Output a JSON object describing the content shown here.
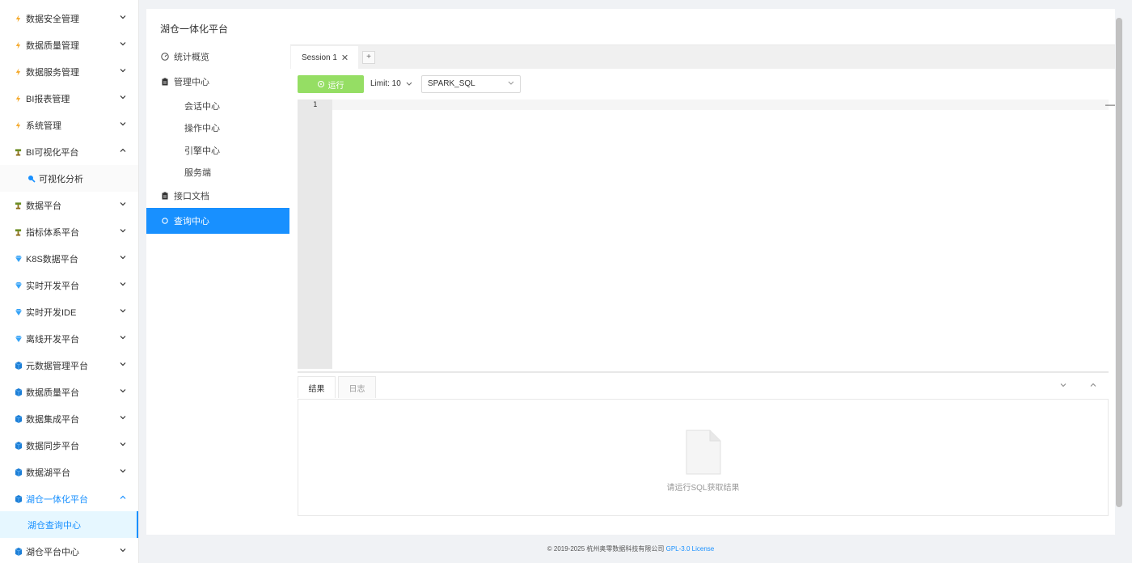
{
  "sidebar": {
    "items": [
      {
        "label": "数据安全管理",
        "icon": "bolt-icon"
      },
      {
        "label": "数据质量管理",
        "icon": "bolt-icon"
      },
      {
        "label": "数据服务管理",
        "icon": "bolt-icon"
      },
      {
        "label": "BI报表管理",
        "icon": "bolt-icon"
      },
      {
        "label": "系统管理",
        "icon": "bolt-icon"
      },
      {
        "label": "BI可视化平台",
        "icon": "tree-icon"
      },
      {
        "label": "可视化分析",
        "icon": "search-icon"
      },
      {
        "label": "数据平台",
        "icon": "tree-icon"
      },
      {
        "label": "指标体系平台",
        "icon": "tree-icon"
      },
      {
        "label": "K8S数据平台",
        "icon": "diamond-icon"
      },
      {
        "label": "实时开发平台",
        "icon": "diamond-icon"
      },
      {
        "label": "实时开发IDE",
        "icon": "diamond-icon"
      },
      {
        "label": "离线开发平台",
        "icon": "diamond-icon"
      },
      {
        "label": "元数据管理平台",
        "icon": "cube-icon"
      },
      {
        "label": "数据质量平台",
        "icon": "cube-icon"
      },
      {
        "label": "数据集成平台",
        "icon": "cube-icon"
      },
      {
        "label": "数据同步平台",
        "icon": "cube-icon"
      },
      {
        "label": "数据湖平台",
        "icon": "cube-icon"
      },
      {
        "label": "湖仓一体化平台",
        "icon": "cube-icon"
      },
      {
        "label": "湖仓查询中心",
        "icon": ""
      },
      {
        "label": "湖仓平台中心",
        "icon": "cube-icon"
      }
    ]
  },
  "panel": {
    "title": "湖仓一体化平台",
    "menu": [
      {
        "label": "统计概览",
        "icon": "dashboard-icon"
      },
      {
        "label": "管理中心",
        "icon": "clipboard-icon"
      },
      {
        "label": "会话中心"
      },
      {
        "label": "操作中心"
      },
      {
        "label": "引擎中心"
      },
      {
        "label": "服务端"
      },
      {
        "label": "接口文档",
        "icon": "clipboard-icon"
      },
      {
        "label": "查询中心",
        "icon": "sun-icon"
      }
    ]
  },
  "workspace": {
    "session_tab": "Session 1",
    "close_glyph": "✕",
    "add_glyph": "+",
    "run_label": "运行",
    "limit_label": "Limit: 10",
    "engine_value": "SPARK_SQL",
    "line_number": "1",
    "minimize_glyph": "—",
    "result_tab": "结果",
    "log_tab": "日志",
    "empty_text": "请运行SQL获取结果"
  },
  "footer": {
    "copyright": "© 2019-2025 杭州奥零数据科技有限公司",
    "license": "GPL-3.0 License"
  },
  "colors": {
    "accent": "#1890ff",
    "run": "#95de64",
    "bolt": "#f5a623",
    "tree": "#8b6914",
    "diamond": "#36a3f7",
    "cube": "#1c7ed6"
  }
}
